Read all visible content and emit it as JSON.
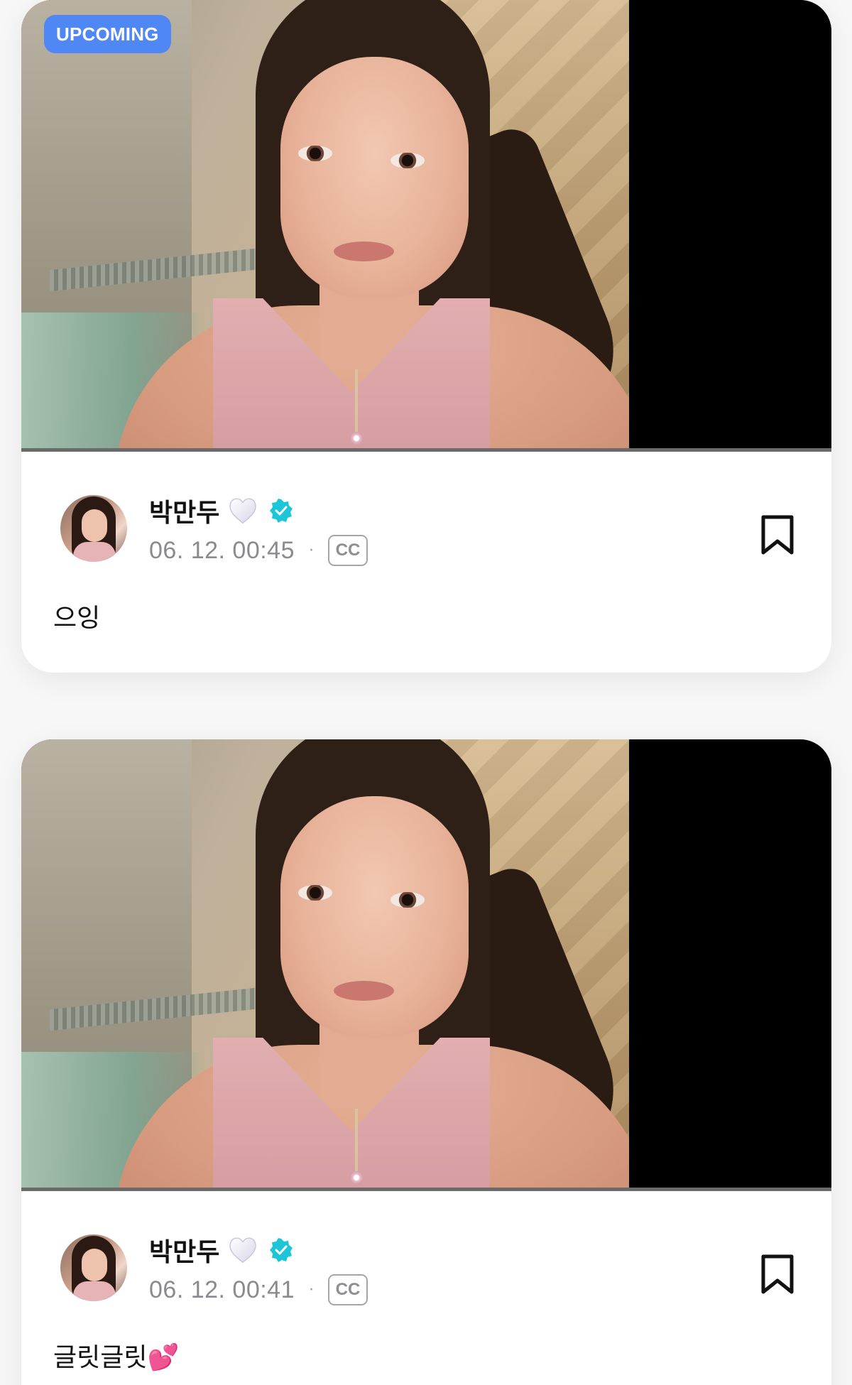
{
  "posts": [
    {
      "badge": "UPCOMING",
      "author": "박만두",
      "timestamp": "06. 12. 00:45",
      "separator": "·",
      "cc_label": "CC",
      "text": "으잉"
    },
    {
      "author": "박만두",
      "timestamp": "06. 12. 00:41",
      "separator": "·",
      "cc_label": "CC",
      "text": "글릿글릿💕"
    }
  ],
  "colors": {
    "badge_bg": "#4f87f5",
    "verified": "#1cc6d6",
    "meta_text": "#8a8a8f",
    "card_bg": "#ffffff",
    "page_bg": "#f7f7f8"
  },
  "icons": [
    "white-heart-icon",
    "verified-check-icon",
    "cc-icon",
    "bookmark-icon",
    "two-hearts-emoji"
  ]
}
